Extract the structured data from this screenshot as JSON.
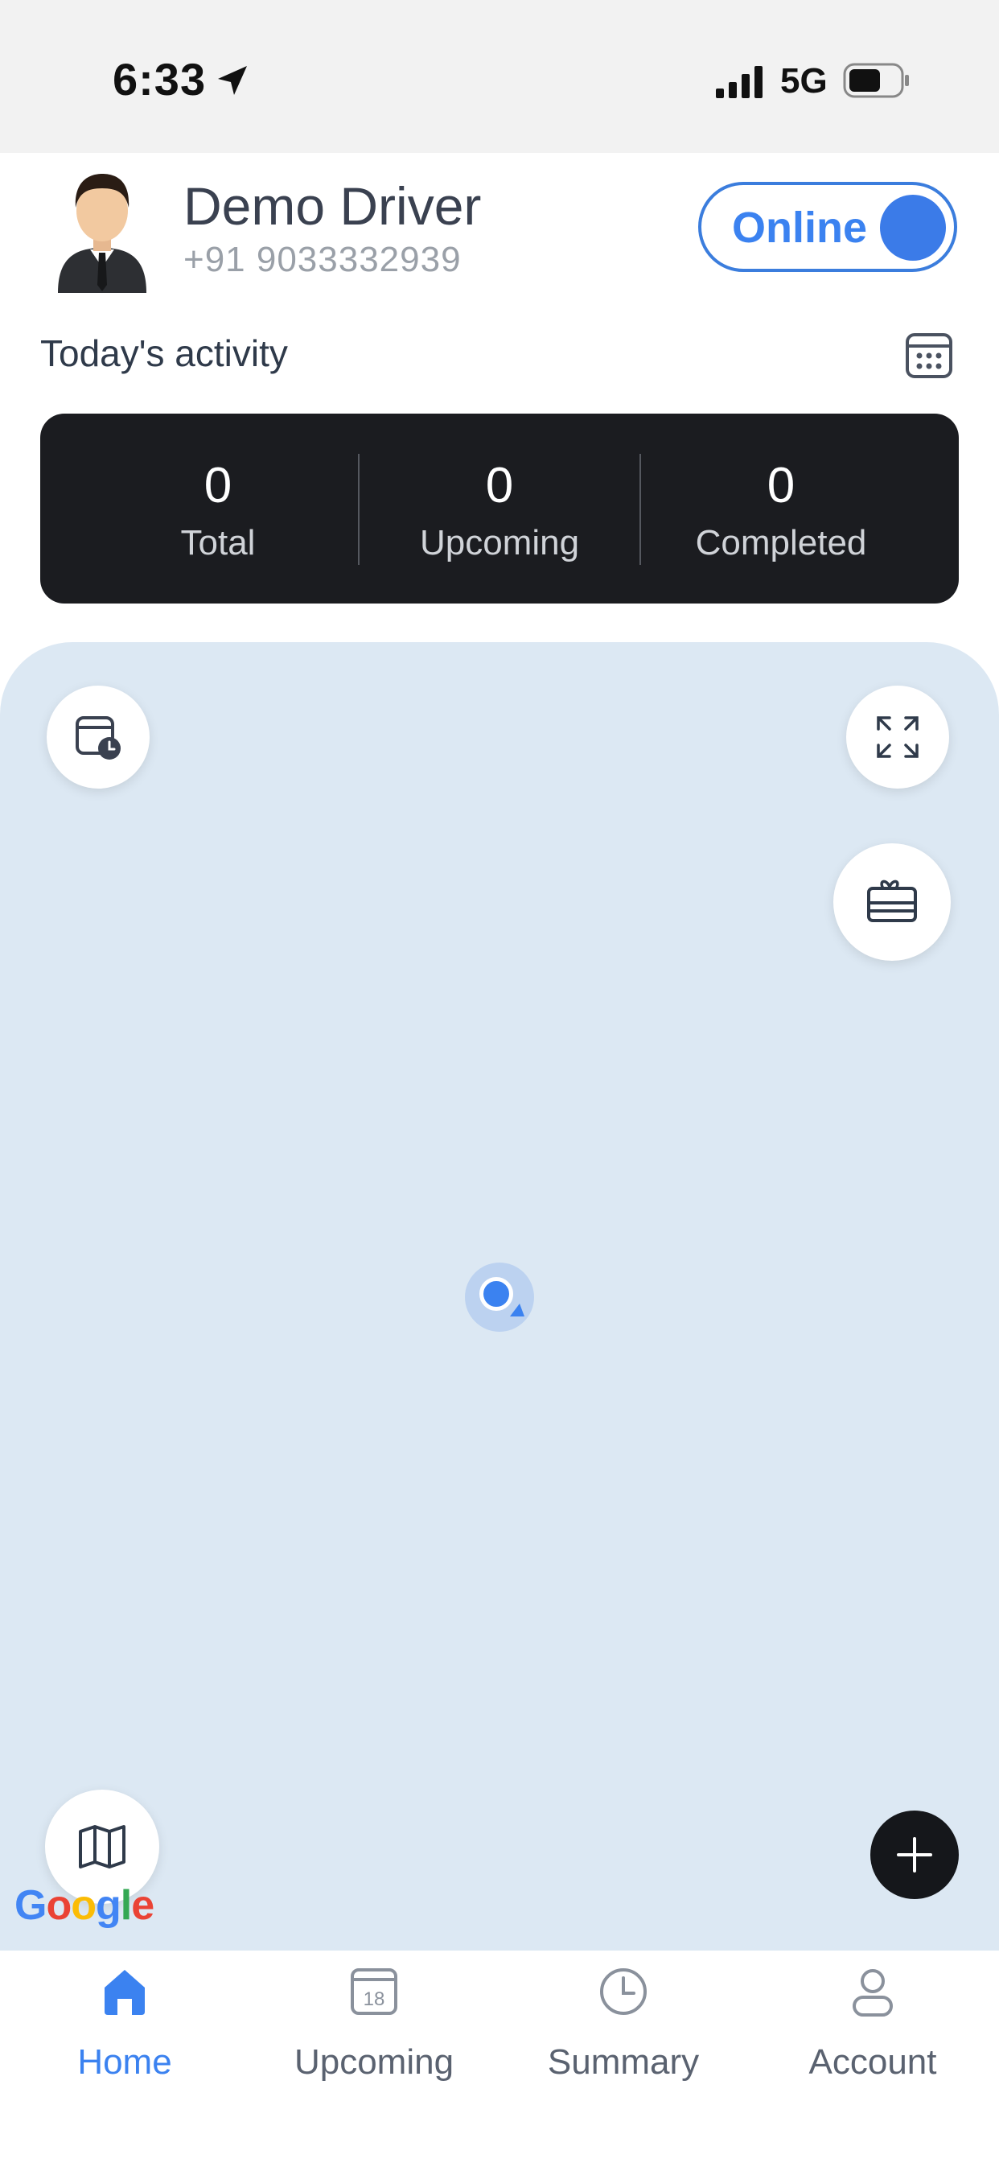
{
  "status_bar": {
    "time": "6:33",
    "network": "5G"
  },
  "driver": {
    "name": "Demo Driver",
    "phone": "+91 9033332939"
  },
  "status_toggle": {
    "label": "Online",
    "on": true
  },
  "activity": {
    "title": "Today's activity",
    "stats": [
      {
        "value": "0",
        "label": "Total"
      },
      {
        "value": "0",
        "label": "Upcoming"
      },
      {
        "value": "0",
        "label": "Completed"
      }
    ]
  },
  "map": {
    "attribution": "Google"
  },
  "bottom_nav": [
    {
      "label": "Home",
      "icon": "home-icon",
      "active": true
    },
    {
      "label": "Upcoming",
      "icon": "calendar-icon",
      "active": false
    },
    {
      "label": "Summary",
      "icon": "clock-icon",
      "active": false
    },
    {
      "label": "Account",
      "icon": "user-icon",
      "active": false
    }
  ],
  "colors": {
    "accent": "#3b82f0",
    "card_dark": "#1b1c20",
    "map_bg": "#dce8f3"
  }
}
